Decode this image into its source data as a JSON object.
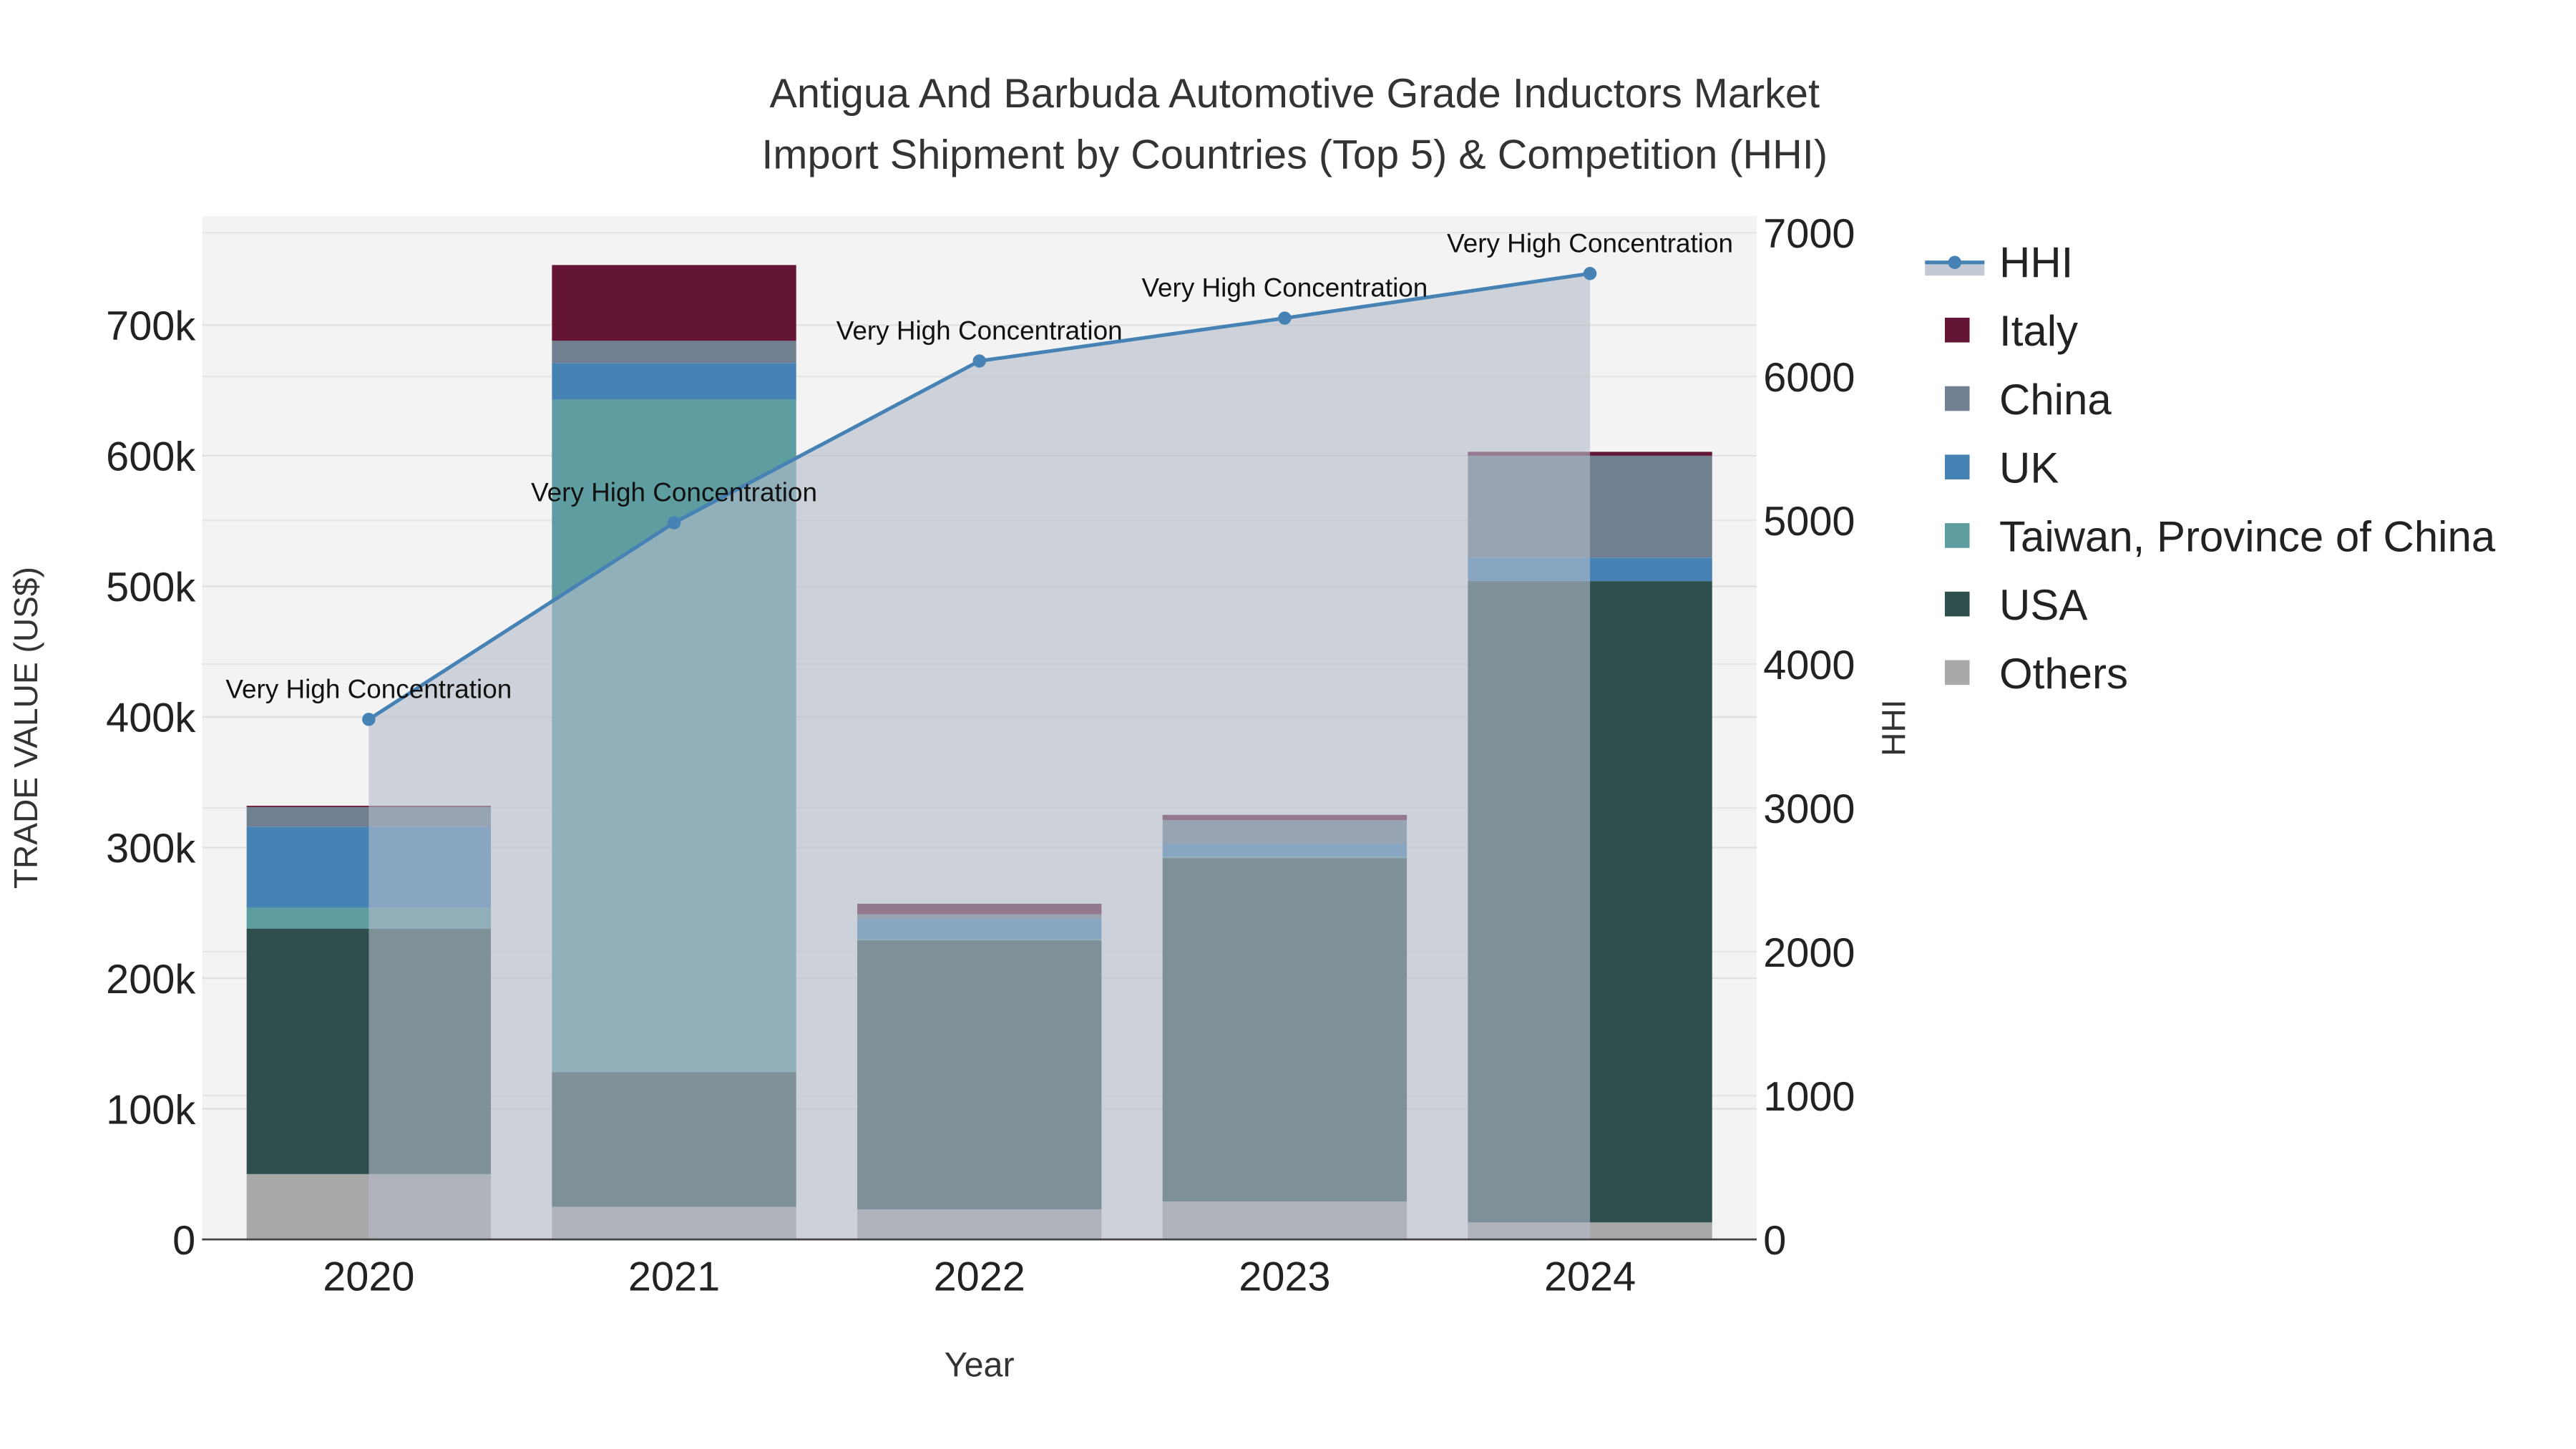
{
  "chart_data": {
    "type": "bar",
    "title": "Antigua And Barbuda Automotive Grade Inductors Market",
    "subtitle": "Import Shipment by Countries (Top 5) & Competition (HHI)",
    "xlabel": "Year",
    "ylabel": "TRADE VALUE (US$)",
    "y2label": "HHI",
    "categories": [
      "2020",
      "2021",
      "2022",
      "2023",
      "2024"
    ],
    "ylim": [
      0,
      780000
    ],
    "y2lim": [
      0,
      7100
    ],
    "yticks": [
      0,
      100000,
      200000,
      300000,
      400000,
      500000,
      600000,
      700000
    ],
    "ytick_labels": [
      "0",
      "100k",
      "200k",
      "300k",
      "400k",
      "500k",
      "600k",
      "700k"
    ],
    "y2ticks": [
      0,
      1000,
      2000,
      3000,
      4000,
      5000,
      6000,
      7000
    ],
    "y2tick_labels": [
      "0",
      "1000",
      "2000",
      "3000",
      "4000",
      "5000",
      "6000",
      "7000"
    ],
    "stacked": true,
    "series": [
      {
        "name": "Others",
        "color": "#A9A9A9",
        "values": [
          50000,
          25000,
          23000,
          29000,
          13000
        ]
      },
      {
        "name": "USA",
        "color": "#2F4F4F",
        "values": [
          188000,
          103000,
          206000,
          263000,
          491000
        ]
      },
      {
        "name": "Taiwan, Province of China",
        "color": "#5F9EA0",
        "values": [
          16000,
          515000,
          1000,
          1000,
          0
        ]
      },
      {
        "name": "UK",
        "color": "#4682B4",
        "values": [
          62000,
          28000,
          15000,
          10000,
          18000
        ]
      },
      {
        "name": "China",
        "color": "#708090",
        "values": [
          15000,
          17000,
          4000,
          18000,
          78000
        ]
      },
      {
        "name": "Italy",
        "color": "#641535",
        "values": [
          1000,
          58000,
          8000,
          4000,
          3000
        ]
      }
    ],
    "hhi": {
      "name": "HHI",
      "color": "#4682B4",
      "values": [
        3616,
        4983,
        6108,
        6406,
        6716
      ],
      "annotations": [
        "Very High Concentration",
        "Very High Concentration",
        "Very High Concentration",
        "Very High Concentration",
        "Very High Concentration"
      ]
    },
    "legend": [
      "HHI",
      "Italy",
      "China",
      "UK",
      "Taiwan, Province of China",
      "USA",
      "Others"
    ],
    "legend_placement": "right",
    "grid": true
  }
}
